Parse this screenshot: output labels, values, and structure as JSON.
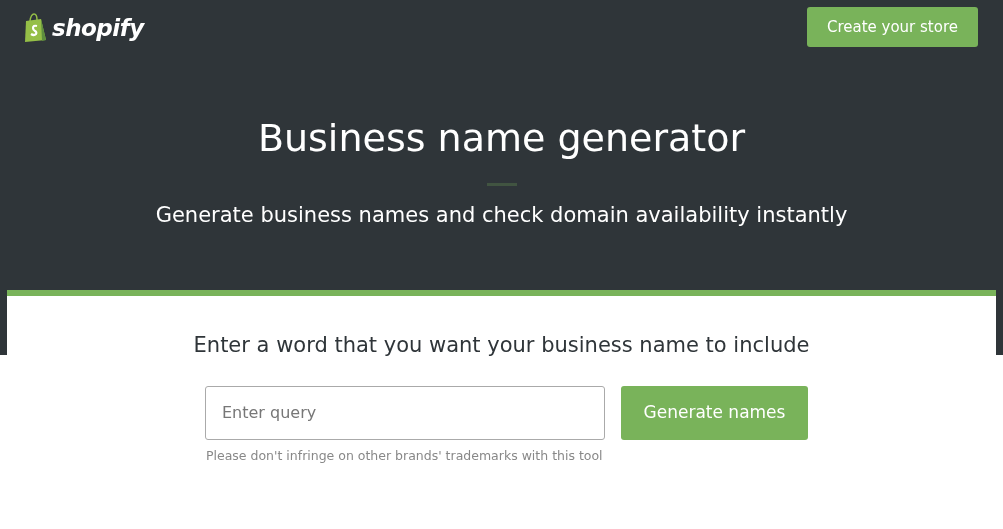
{
  "header": {
    "logo": "shopify",
    "cta": "Create your store"
  },
  "hero": {
    "title": "Business name generator",
    "subtitle": "Generate business names and check domain availability instantly"
  },
  "form": {
    "prompt": "Enter a word that you want your business name to include",
    "placeholder": "Enter query",
    "button": "Generate names",
    "note": "Please don't infringe on other brands' trademarks with this tool"
  }
}
